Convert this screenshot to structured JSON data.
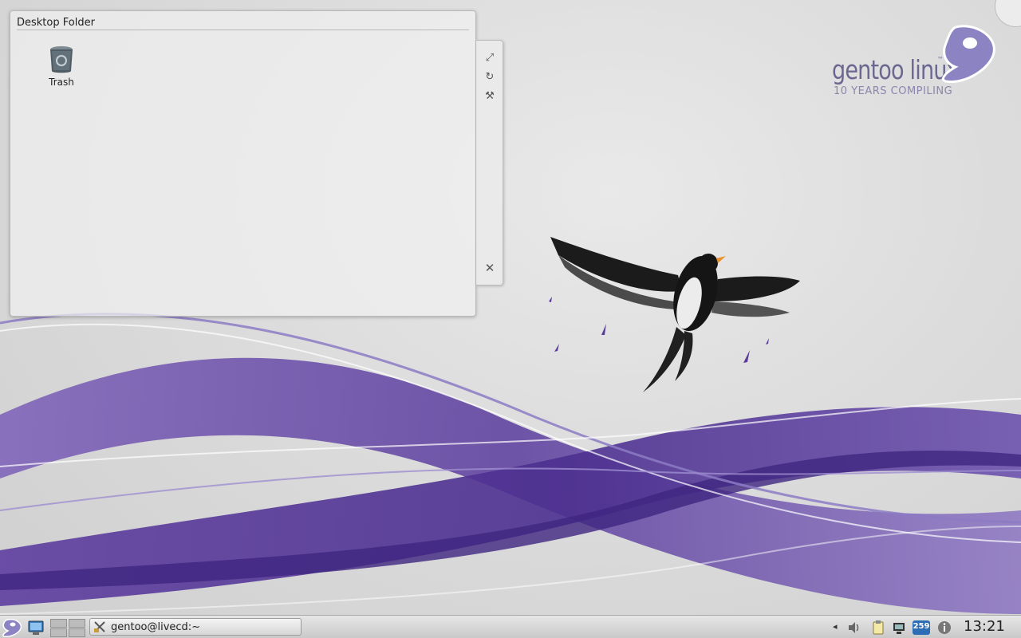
{
  "folder": {
    "title": "Desktop Folder",
    "items": [
      {
        "label": "Trash",
        "icon": "trash-icon"
      }
    ]
  },
  "applet_handle": {
    "buttons": [
      {
        "name": "resize-icon",
        "glyph": "⤢"
      },
      {
        "name": "rotate-icon",
        "glyph": "↻"
      },
      {
        "name": "settings-wrench-icon",
        "glyph": "⚒"
      },
      {
        "name": "close-icon",
        "glyph": "✕"
      }
    ]
  },
  "logo": {
    "name": "gentoo linux",
    "trademark": "™",
    "tagline": "10 YEARS COMPILING"
  },
  "taskbar": {
    "task_label": "gentoo@livecd:~",
    "tray_arrow": "◂",
    "battery_badge": "259",
    "clock": "13:21"
  },
  "colors": {
    "accent_purple": "#5b3f9b",
    "logo_text": "#6b6790",
    "panel": "#d8d8d8"
  }
}
